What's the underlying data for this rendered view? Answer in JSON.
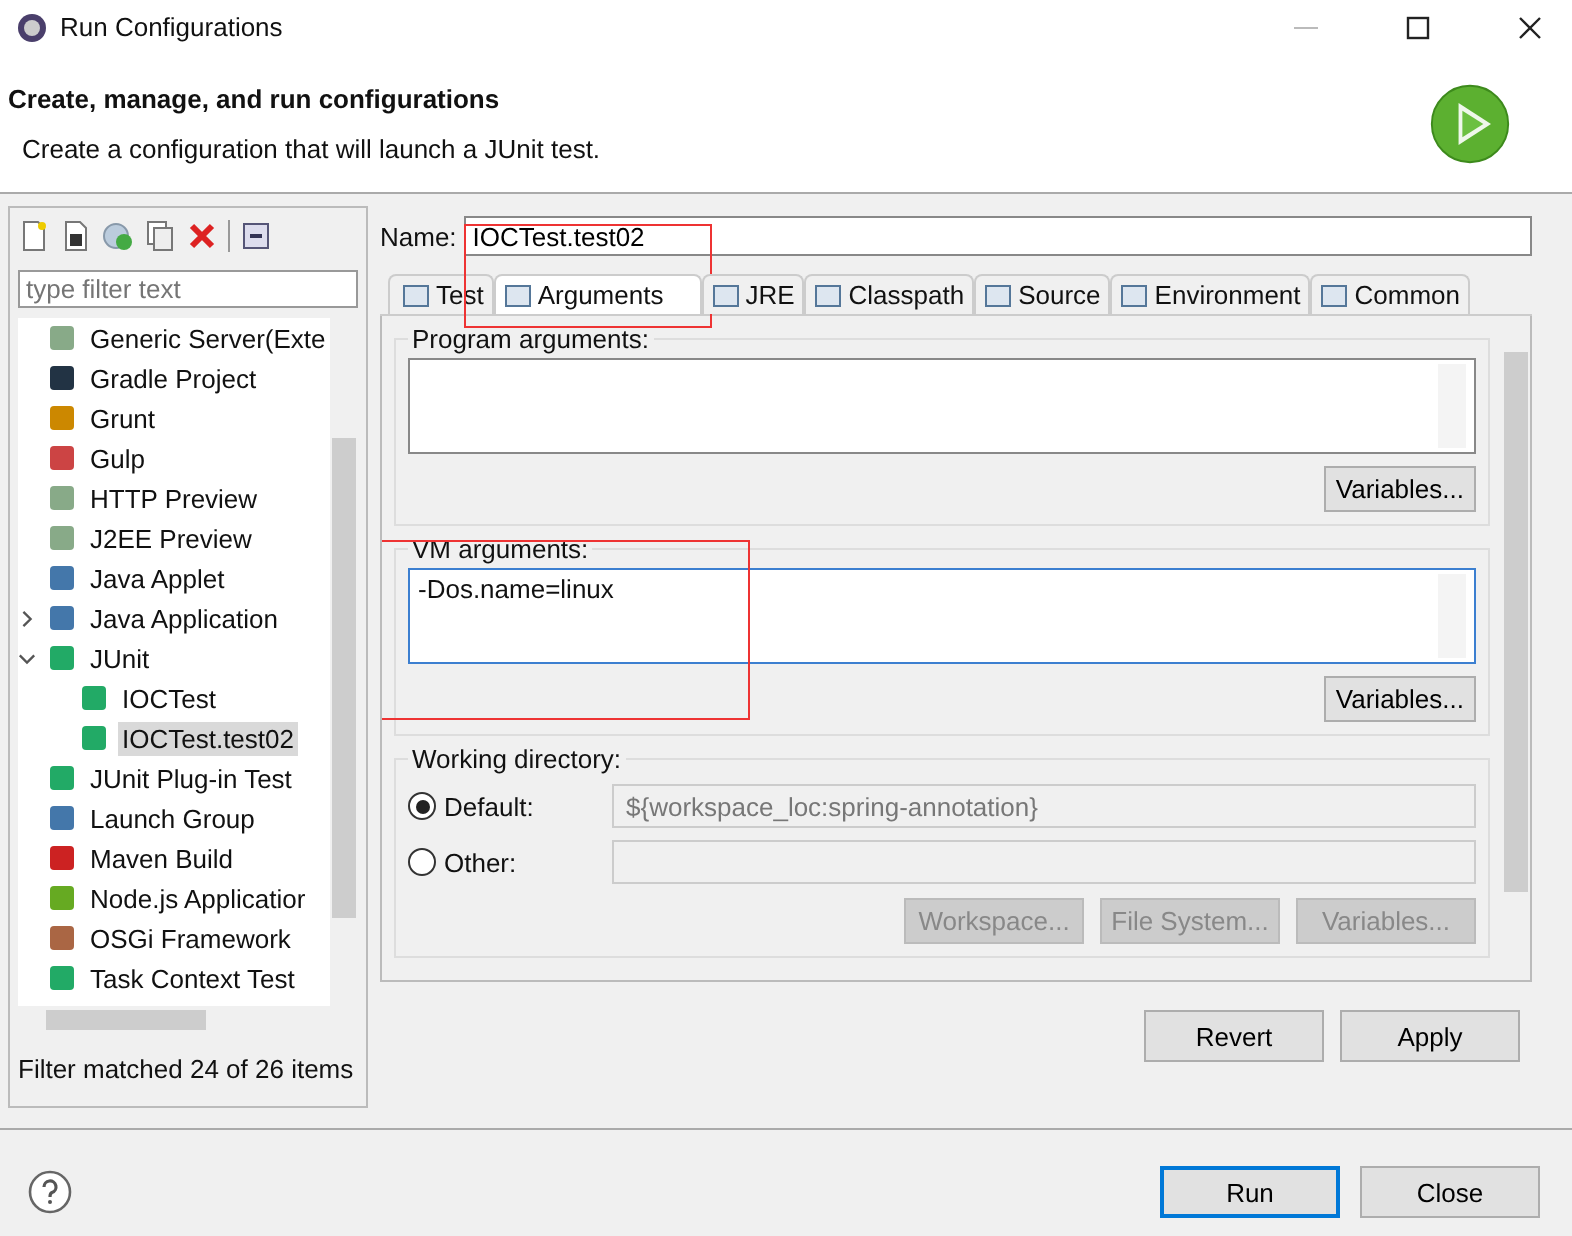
{
  "window": {
    "title": "Run Configurations"
  },
  "header": {
    "title": "Create, manage, and run configurations",
    "message": "Create a configuration that will launch a JUnit test."
  },
  "sidebar": {
    "filter": {
      "placeholder": "type filter text"
    },
    "items": [
      {
        "label": "Generic Server(Exte",
        "selected": false
      },
      {
        "label": "Gradle Project",
        "selected": false
      },
      {
        "label": "Grunt",
        "selected": false
      },
      {
        "label": "Gulp",
        "selected": false
      },
      {
        "label": "HTTP Preview",
        "selected": false
      },
      {
        "label": "J2EE Preview",
        "selected": false
      },
      {
        "label": "Java Applet",
        "selected": false
      },
      {
        "label": "Java Application",
        "selected": false,
        "expanded": false
      },
      {
        "label": "JUnit",
        "selected": false,
        "expanded": true,
        "children": [
          {
            "label": "IOCTest",
            "selected": false
          },
          {
            "label": "IOCTest.test02",
            "selected": true
          }
        ]
      },
      {
        "label": "JUnit Plug-in Test",
        "selected": false
      },
      {
        "label": "Launch Group",
        "selected": false
      },
      {
        "label": "Maven Build",
        "selected": false
      },
      {
        "label": "Node.js Applicatior",
        "selected": false
      },
      {
        "label": "OSGi Framework",
        "selected": false
      },
      {
        "label": "Task Context Test",
        "selected": false
      }
    ],
    "status": "Filter matched 24 of 26 items"
  },
  "name_field": {
    "label": "Name:",
    "value": "IOCTest.test02"
  },
  "tabs": [
    {
      "label": "Test",
      "selected": false,
      "highlighted": false
    },
    {
      "label": "Arguments",
      "selected": true,
      "highlighted": true
    },
    {
      "label": "JRE",
      "selected": false,
      "highlighted": false
    },
    {
      "label": "Classpath",
      "selected": false,
      "highlighted": false
    },
    {
      "label": "Source",
      "selected": false,
      "highlighted": false
    },
    {
      "label": "Environment",
      "selected": false,
      "highlighted": false
    },
    {
      "label": "Common",
      "selected": false,
      "highlighted": false
    }
  ],
  "program_arguments": {
    "label": "Program arguments:",
    "button": "Variables..."
  },
  "vm_arguments": {
    "label": "VM arguments:",
    "value": "-Dos.name=linux",
    "button": "Variables...",
    "highlighted": true
  },
  "working_directory": {
    "label": "Working directory:",
    "options": [
      {
        "label": "Default:",
        "selected": true,
        "value": "${workspace_loc:spring-annotation}"
      },
      {
        "label": "Other:",
        "selected": false
      }
    ],
    "buttons": [
      "Workspace...",
      "File System...",
      "Variables..."
    ]
  },
  "actions": [
    "Revert",
    "Apply"
  ],
  "footer_buttons": [
    {
      "label": "Run",
      "selected": true
    },
    {
      "label": "Close",
      "selected": false
    }
  ]
}
